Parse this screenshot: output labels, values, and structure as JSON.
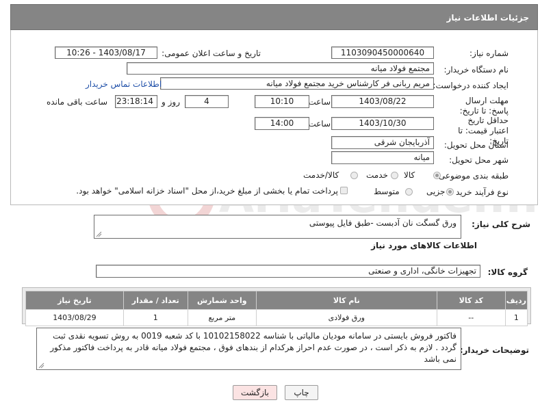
{
  "header": {
    "title": "جزئیات اطلاعات نیاز"
  },
  "form": {
    "need_number_label": "شماره نیاز:",
    "need_number": "1103090450000640",
    "announce_label": "تاریخ و ساعت اعلان عمومی:",
    "announce_value": "1403/08/17 - 10:26",
    "buyer_org_label": "نام دستگاه خریدار:",
    "buyer_org": "مجتمع فولاد میانه",
    "creator_label": "ایجاد کننده درخواست:",
    "creator": "مریم ربانی فر کارشناس خرید مجتمع فولاد میانه",
    "contact_link": "اطلاعات تماس خریدار",
    "reply_deadline_label": "مهلت ارسال پاسخ: تا تاریخ:",
    "reply_date": "1403/08/22",
    "time_label": "ساعت",
    "reply_time": "10:10",
    "days_value": "4",
    "days_label": "روز و",
    "remaining_time": "23:18:14",
    "remaining_label": "ساعت باقی مانده",
    "price_validity_label": "حداقل تاریخ اعتبار قیمت: تا تاریخ:",
    "validity_date": "1403/10/30",
    "validity_time": "14:00",
    "province_label": "استان محل تحویل:",
    "province": "آذربایجان شرقی",
    "city_label": "شهر محل تحویل:",
    "city": "میانه",
    "category_label": "طبقه بندی موضوعی:",
    "category_options": [
      "کالا",
      "خدمت",
      "کالا/خدمت"
    ],
    "category_selected": "کالا",
    "process_label": "نوع فرآیند خرید :",
    "process_options": [
      "جزیی",
      "متوسط"
    ],
    "process_selected": "جزیی",
    "payment_note": "پرداخت تمام یا بخشی از مبلغ خرید،از محل \"اسناد خزانه اسلامی\" خواهد بود."
  },
  "description": {
    "label": "شرح کلی نیاز:",
    "text": "ورق  گسگت نان آدبست -طبق فایل پیوستی"
  },
  "goods": {
    "section_title": "اطلاعات کالاهای مورد نیاز",
    "group_label": "گروه کالا:",
    "group_value": "تجهیزات خانگی، اداری و صنعتی",
    "columns": [
      "ردیف",
      "کد کالا",
      "نام کالا",
      "واحد شمارش",
      "تعداد / مقدار",
      "تاریخ نیاز"
    ],
    "rows": [
      {
        "row": "1",
        "code": "--",
        "name": "ورق فولادی",
        "unit": "متر مربع",
        "qty": "1",
        "date": "1403/08/29"
      }
    ]
  },
  "buyer_notes": {
    "label": "توضیحات خریدار:",
    "text": "فاکتور فروش بایستی در سامانه مودیان مالیاتی با شناسه 10102158022 با کد شعبه 0019 به روش تسویه نقدی ثبت گردد . لازم به ذکر است ، در صورت عدم احراز هرکدام از بندهای فوق ، مجتمع فولاد میانه قادر به پرداخت فاکتور مذکور نمی باشد"
  },
  "buttons": {
    "print": "چاپ",
    "back": "بازگشت"
  },
  "watermark": {
    "text": "AriaTender.net"
  },
  "colors": {
    "header_bg": "#858585",
    "link": "#1f4fa8",
    "back_button_bg": "#fbe3e3"
  }
}
